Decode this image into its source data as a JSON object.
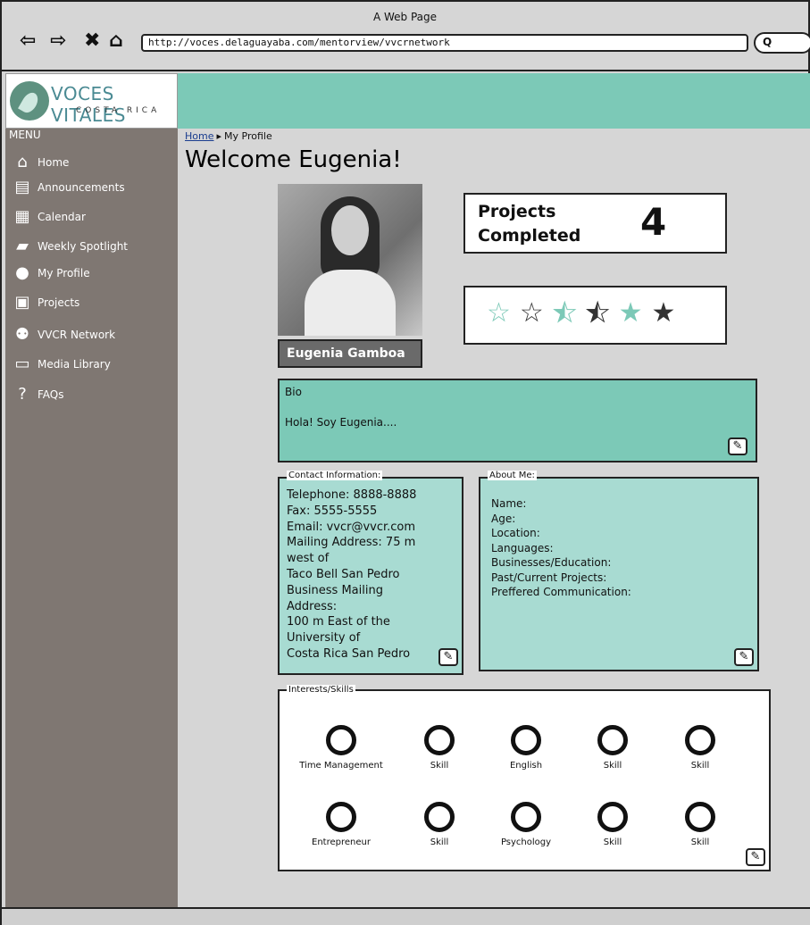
{
  "browser": {
    "title": "A Web Page",
    "url": "http://voces.delaguayaba.com/mentorview/vvcrnetwork",
    "search_icon": "search-icon"
  },
  "sidebar": {
    "logo_text": "VOCES VITALES",
    "logo_subtext": "COSTA RICA",
    "menu_title": "MENU",
    "items": [
      {
        "label": "Home",
        "icon": "house-icon"
      },
      {
        "label": "Announcements",
        "icon": "newspaper-icon"
      },
      {
        "label": "Calendar",
        "icon": "calendar-icon"
      },
      {
        "label": "Weekly Spotlight",
        "icon": "notebook-icon"
      },
      {
        "label": "My Profile",
        "icon": "person-icon"
      },
      {
        "label": "Projects",
        "icon": "folder-icon"
      },
      {
        "label": "VVCR Network",
        "icon": "people-icon"
      },
      {
        "label": "Media Library",
        "icon": "monitor-icon"
      },
      {
        "label": "FAQs",
        "icon": "question-icon"
      }
    ]
  },
  "breadcrumb": {
    "home": "Home",
    "current": "My Profile"
  },
  "page": {
    "welcome": "Welcome Eugenia!"
  },
  "profile": {
    "name": "Eugenia Gamboa"
  },
  "stats": {
    "projects_label_line1": "Projects",
    "projects_label_line2": "Completed",
    "projects_value": "4"
  },
  "rating": {
    "stars": [
      {
        "style": "outline",
        "color": "#7cc9b7"
      },
      {
        "style": "outline",
        "color": "#333333"
      },
      {
        "style": "half",
        "color": "#7cc9b7"
      },
      {
        "style": "half",
        "color": "#333333"
      },
      {
        "style": "filled",
        "color": "#7cc9b7"
      },
      {
        "style": "filled",
        "color": "#333333"
      }
    ]
  },
  "bio": {
    "heading": "Bio",
    "text": "Hola! Soy Eugenia...."
  },
  "contact": {
    "legend": "Contact Information:",
    "lines": [
      "Telephone: 8888-8888",
      "Fax: 5555-5555",
      "Email: vvcr@vvcr.com",
      "Mailing Address: 75 m",
      "west of",
      "Taco Bell San Pedro",
      "Business Mailing",
      "Address:",
      "100 m East of the",
      "University of",
      "Costa Rica San Pedro"
    ]
  },
  "about": {
    "legend": "About Me:",
    "lines": [
      "Name:",
      "Age:",
      "Location:",
      "Languages:",
      "Businesses/Education:",
      "Past/Current Projects:",
      "Preffered Communication:"
    ]
  },
  "skills": {
    "legend": "Interests/Skills",
    "items": [
      "Time Management",
      "Skill",
      "English",
      "Skill",
      "Skill",
      "Entrepreneur",
      "Skill",
      "Psychology",
      "Skill",
      "Skill"
    ]
  },
  "colors": {
    "teal": "#7cc9b7",
    "sidebar": "#7f7772",
    "light_teal": "#a8dbd2"
  }
}
